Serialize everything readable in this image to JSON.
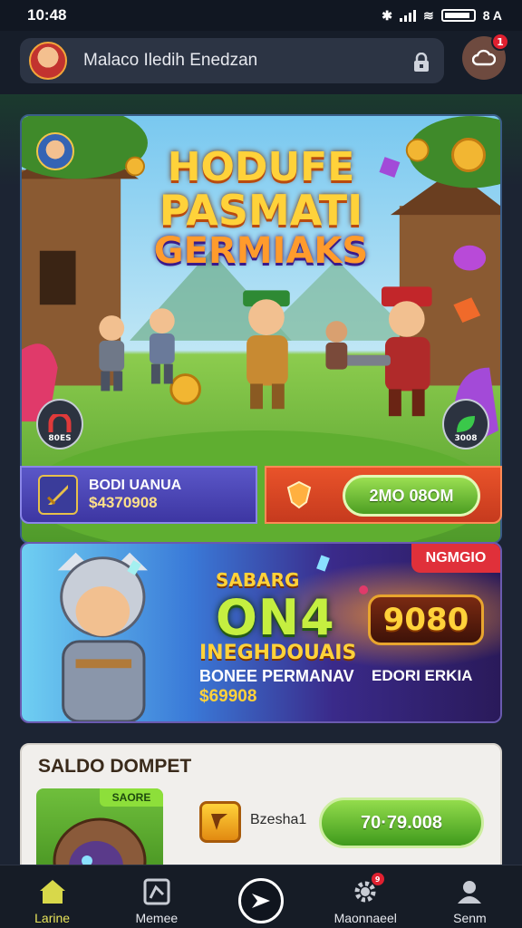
{
  "status_bar": {
    "time": "10:48",
    "right_text": "8 A"
  },
  "header": {
    "search_text": "Malaco Iledih Enedzan",
    "notification_count": "1"
  },
  "hero": {
    "title_line1": "HODUFE",
    "title_line2": "PASMATI",
    "title_line3": "GERMIAKS",
    "badge_left": "80ES",
    "badge_right": "3008"
  },
  "info_left": {
    "title": "BODI UANUA",
    "value": "$4370908"
  },
  "info_right": {
    "button": "2MO 08OM"
  },
  "promo": {
    "ribbon": "NGMGIO",
    "line_a": "SABARG",
    "line_b": "ON4",
    "line_c": "INEGHDOUAIS",
    "line_d": "BONEE PERMANAV",
    "line_e": "$69908",
    "jackpot": "9080",
    "line_f": "EDORI ERKIA"
  },
  "wallet": {
    "title": "SALDO DOMPET",
    "image_tag": "SAORE",
    "item_text": "Bzesha1",
    "button": "70·79.008"
  },
  "bottom_nav": {
    "items": [
      {
        "label": "Larine",
        "icon": "home-icon"
      },
      {
        "label": "Memee",
        "icon": "grid-icon"
      },
      {
        "label": "",
        "icon": "play-icon"
      },
      {
        "label": "Maonnaeel",
        "icon": "gear-icon"
      },
      {
        "label": "Senm",
        "icon": "user-icon"
      }
    ],
    "settings_badge": "9"
  },
  "colors": {
    "accent_green": "#5fb42a",
    "accent_red": "#e02030",
    "accent_gold": "#ffd23a",
    "nav_active": "#e8e45a"
  }
}
